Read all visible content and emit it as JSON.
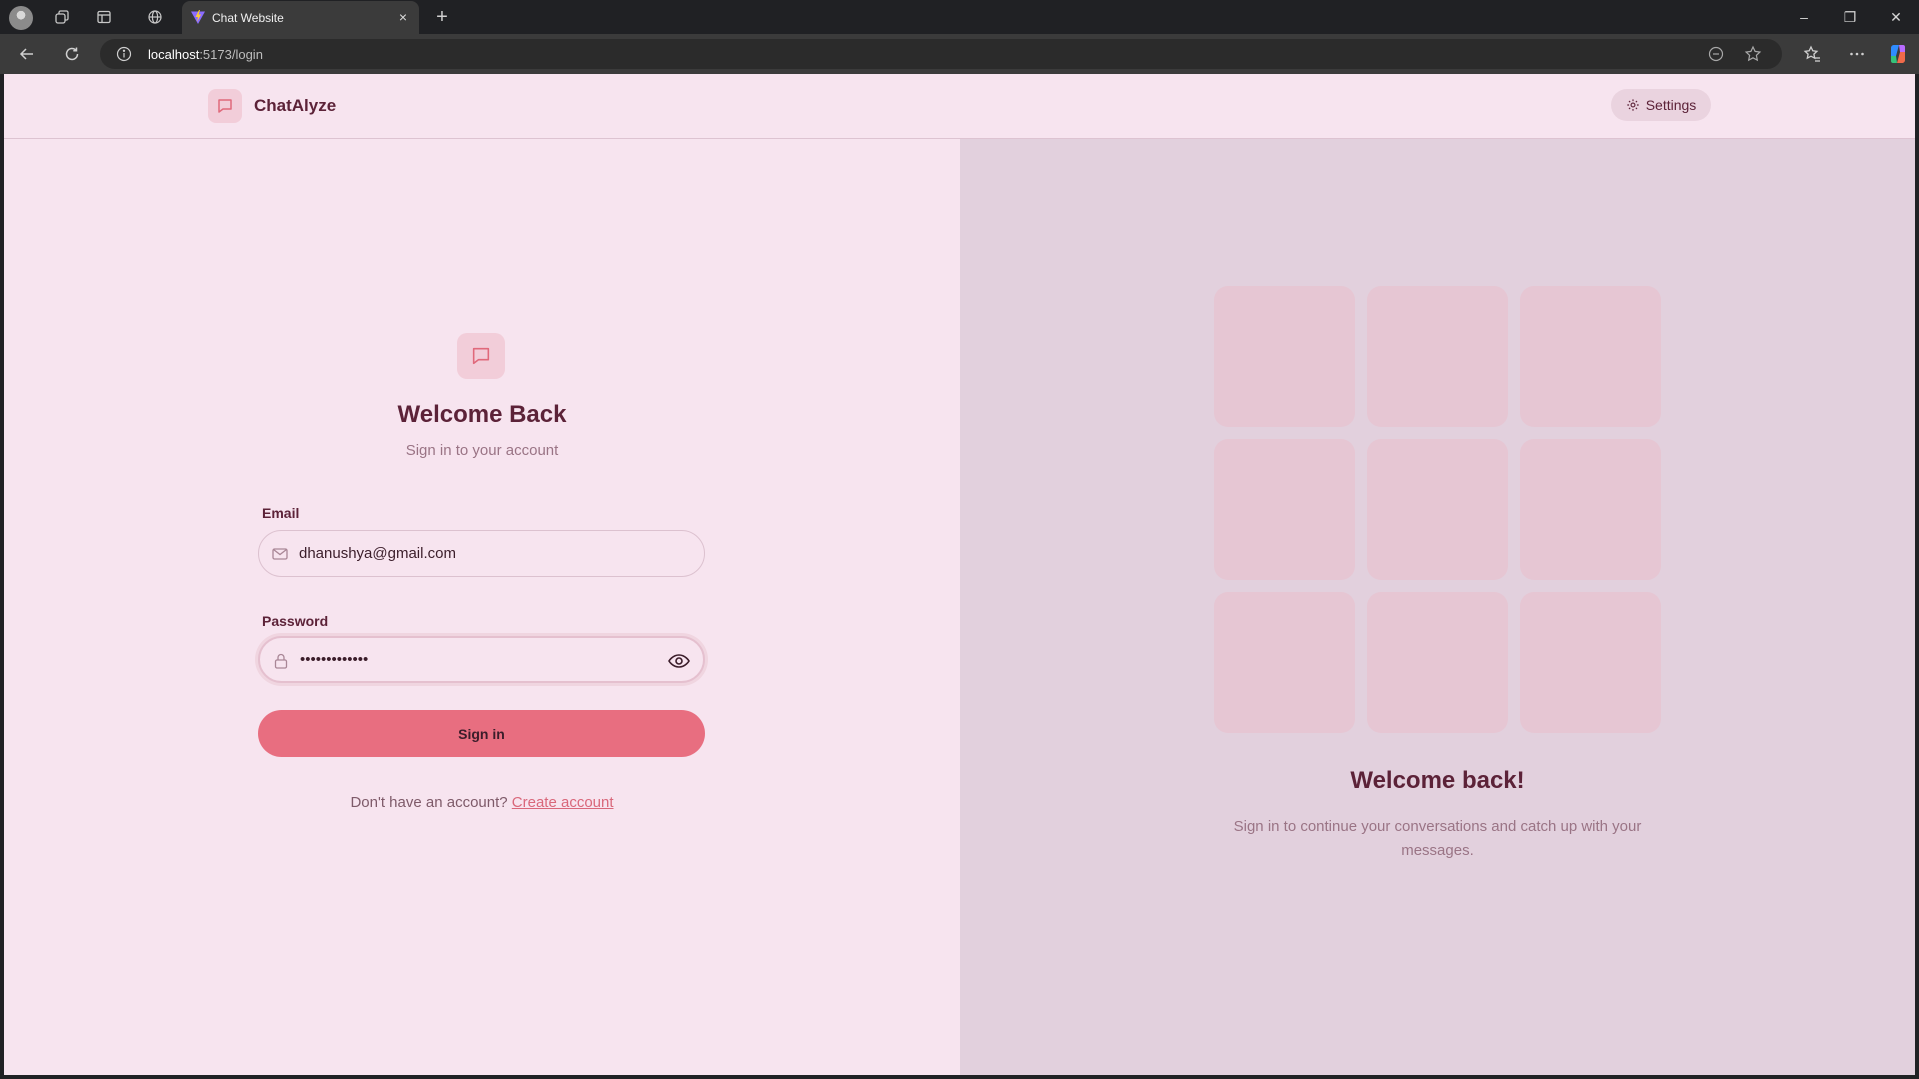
{
  "browser": {
    "tab_title": "Chat Website",
    "tab_close": "×",
    "new_tab": "+",
    "url_host": "localhost",
    "url_rest": ":5173/login",
    "window_controls": [
      "–",
      "❐",
      "✕"
    ]
  },
  "header": {
    "brand": "ChatAlyze",
    "settings_label": "Settings"
  },
  "login": {
    "title": "Welcome Back",
    "subtitle": "Sign in to your account",
    "email_label": "Email",
    "email_value": "dhanushya@gmail.com",
    "password_label": "Password",
    "password_value": "•••••••••••••",
    "submit_label": "Sign in",
    "signup_prompt": "Don't have an account? ",
    "signup_link": "Create account"
  },
  "promo": {
    "title": "Welcome back!",
    "text": "Sign in to continue your conversations and catch up with your messages.",
    "tile_count": 9
  },
  "colors": {
    "page_bg": "#f7e4ef",
    "right_bg": "#e2d0dd",
    "accent": "#e86e80",
    "heading": "#5c2238",
    "link": "#d9677a"
  },
  "icons": {
    "logo": "message-square-icon",
    "settings": "gear-icon",
    "email": "mail-icon",
    "password": "lock-icon",
    "toggle_password": "eye-icon"
  }
}
